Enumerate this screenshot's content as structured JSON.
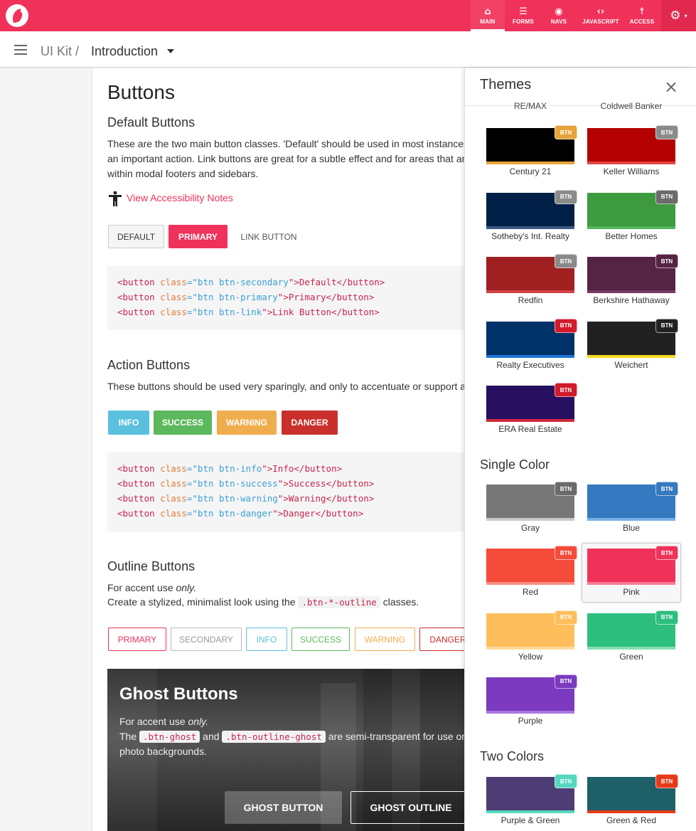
{
  "app": {
    "brand": "UI Kit logo"
  },
  "nav": {
    "items": [
      {
        "label": "MAIN",
        "icon": "home-icon",
        "glyph": "⌂"
      },
      {
        "label": "FORMS",
        "icon": "list-icon",
        "glyph": "☰"
      },
      {
        "label": "NAVS",
        "icon": "compass-icon",
        "glyph": "◉"
      },
      {
        "label": "JAVASCRIPT",
        "icon": "code-icon",
        "glyph": "‹›"
      },
      {
        "label": "ACCESS",
        "icon": "accessibility-icon",
        "glyph": "☨"
      }
    ],
    "settings_glyph": "⚙",
    "caret": "▾"
  },
  "breadcrumb": {
    "root": "UI Kit /",
    "current": "Introduction"
  },
  "main": {
    "title": "Buttons",
    "default": {
      "heading": "Default Buttons",
      "line1": "These are the two main button classes. 'Default' should be used in most instances,",
      "line2": "an important action. Link buttons are great for a subtle effect and for areas that are",
      "line3": "within modal footers and sidebars.",
      "a11y_link": "View Accessibility Notes",
      "buttons": [
        "DEFAULT",
        "PRIMARY",
        "LINK BUTTON"
      ],
      "code": [
        [
          "<button ",
          "class",
          "=\"",
          "btn btn-secondary",
          "\">Default</button>"
        ],
        [
          "<button ",
          "class",
          "=\"",
          "btn btn-primary",
          "\">Primary</button>"
        ],
        [
          "<button ",
          "class",
          "=\"",
          "btn btn-link",
          "\">Link Button</button>"
        ]
      ]
    },
    "action": {
      "heading": "Action Buttons",
      "line1": "These buttons should be used very sparingly, and only to accentuate or support an",
      "buttons": [
        "INFO",
        "SUCCESS",
        "WARNING",
        "DANGER"
      ],
      "code": [
        [
          "<button ",
          "class",
          "=\"",
          "btn btn-info",
          "\">Info</button>"
        ],
        [
          "<button ",
          "class",
          "=\"",
          "btn btn-success",
          "\">Success</button>"
        ],
        [
          "<button ",
          "class",
          "=\"",
          "btn btn-warning",
          "\">Warning</button>"
        ],
        [
          "<button ",
          "class",
          "=\"",
          "btn btn-danger",
          "\">Danger</button>"
        ]
      ]
    },
    "outline": {
      "heading": "Outline Buttons",
      "accent_pre": "For accent use ",
      "accent_em": "only.",
      "line2_pre": "Create a stylized, minimalist look using the ",
      "line2_code": ".btn-*-outline",
      "line2_post": " classes.",
      "buttons": [
        "PRIMARY",
        "SECONDARY",
        "INFO",
        "SUCCESS",
        "WARNING",
        "DANGER"
      ]
    },
    "ghost": {
      "heading": "Ghost Buttons",
      "accent_pre": "For accent use ",
      "accent_em": "only.",
      "the": "The ",
      "code1": ".btn-ghost",
      "and": " and ",
      "code2": ".btn-outline-ghost",
      "rest": " are semi-transparent for use on",
      "line3": "photo backgrounds.",
      "btn1": "GHOST BUTTON",
      "btn2": "GHOST OUTLINE"
    }
  },
  "themes": {
    "title": "Themes",
    "close": "×",
    "badge": "BTN",
    "cut_labels": [
      "RE/MAX",
      "Coldwell Banker"
    ],
    "brands": [
      {
        "name": "Century 21",
        "color": "#000000",
        "bar": "#e6a33a",
        "badge": "#e6a33a"
      },
      {
        "name": "Keller Williams",
        "color": "#b40101",
        "bar": "#e34646",
        "badge": "#8a8a8a"
      },
      {
        "name": "Sotheby's Int. Realty",
        "color": "#002048",
        "bar": "#3b5b86",
        "badge": "#8a8a8a"
      },
      {
        "name": "Better Homes",
        "color": "#3d9a3f",
        "bar": "#54b55a",
        "badge": "#6a6a6a"
      },
      {
        "name": "Redfin",
        "color": "#a02021",
        "bar": "#d34445",
        "badge": "#8a8a8a"
      },
      {
        "name": "Berkshire Hathaway",
        "color": "#552344",
        "bar": "#7a3b66",
        "badge": "#552344"
      },
      {
        "name": "Realty Executives",
        "color": "#003168",
        "bar": "#1c74d9",
        "badge": "#d11a2a"
      },
      {
        "name": "Weichert",
        "color": "#212121",
        "bar": "#f6da21",
        "badge": "#212121"
      },
      {
        "name": "ERA Real Estate",
        "color": "#27105f",
        "bar": "#d12a3d",
        "badge": "#d11a2a"
      }
    ],
    "single_heading": "Single Color",
    "single": [
      {
        "name": "Gray",
        "color": "#777777",
        "bar": "#c9c9c9",
        "badge": "#6a6a6a"
      },
      {
        "name": "Blue",
        "color": "#3579c0",
        "bar": "#7aaee6",
        "badge": "#3579c0"
      },
      {
        "name": "Red",
        "color": "#f44b3b",
        "bar": "#fa8f84",
        "badge": "#f44b3b"
      },
      {
        "name": "Pink",
        "color": "#f0325a",
        "bar": "#f77a95",
        "badge": "#f0325a"
      },
      {
        "name": "Yellow",
        "color": "#fdbe5b",
        "bar": "#fddb9f",
        "badge": "#fdbe5b"
      },
      {
        "name": "Green",
        "color": "#2dbf7e",
        "bar": "#86dfb6",
        "badge": "#2dbf7e"
      },
      {
        "name": "Purple",
        "color": "#7b3abf",
        "bar": "#a978e0",
        "badge": "#7b3abf"
      }
    ],
    "two_heading": "Two Colors",
    "two": [
      {
        "name": "Purple & Green",
        "color": "#4e3c74",
        "bar": "#55d8c0",
        "badge": "#55d8c0"
      },
      {
        "name": "Green & Red",
        "color": "#1e5f68",
        "bar": "#e73a19",
        "badge": "#e73a19"
      }
    ]
  },
  "colors": {
    "brand": "#f0325a",
    "info": "#5bc0de",
    "success": "#5cb85c",
    "warning": "#f0ad4e",
    "danger": "#c9302c"
  }
}
